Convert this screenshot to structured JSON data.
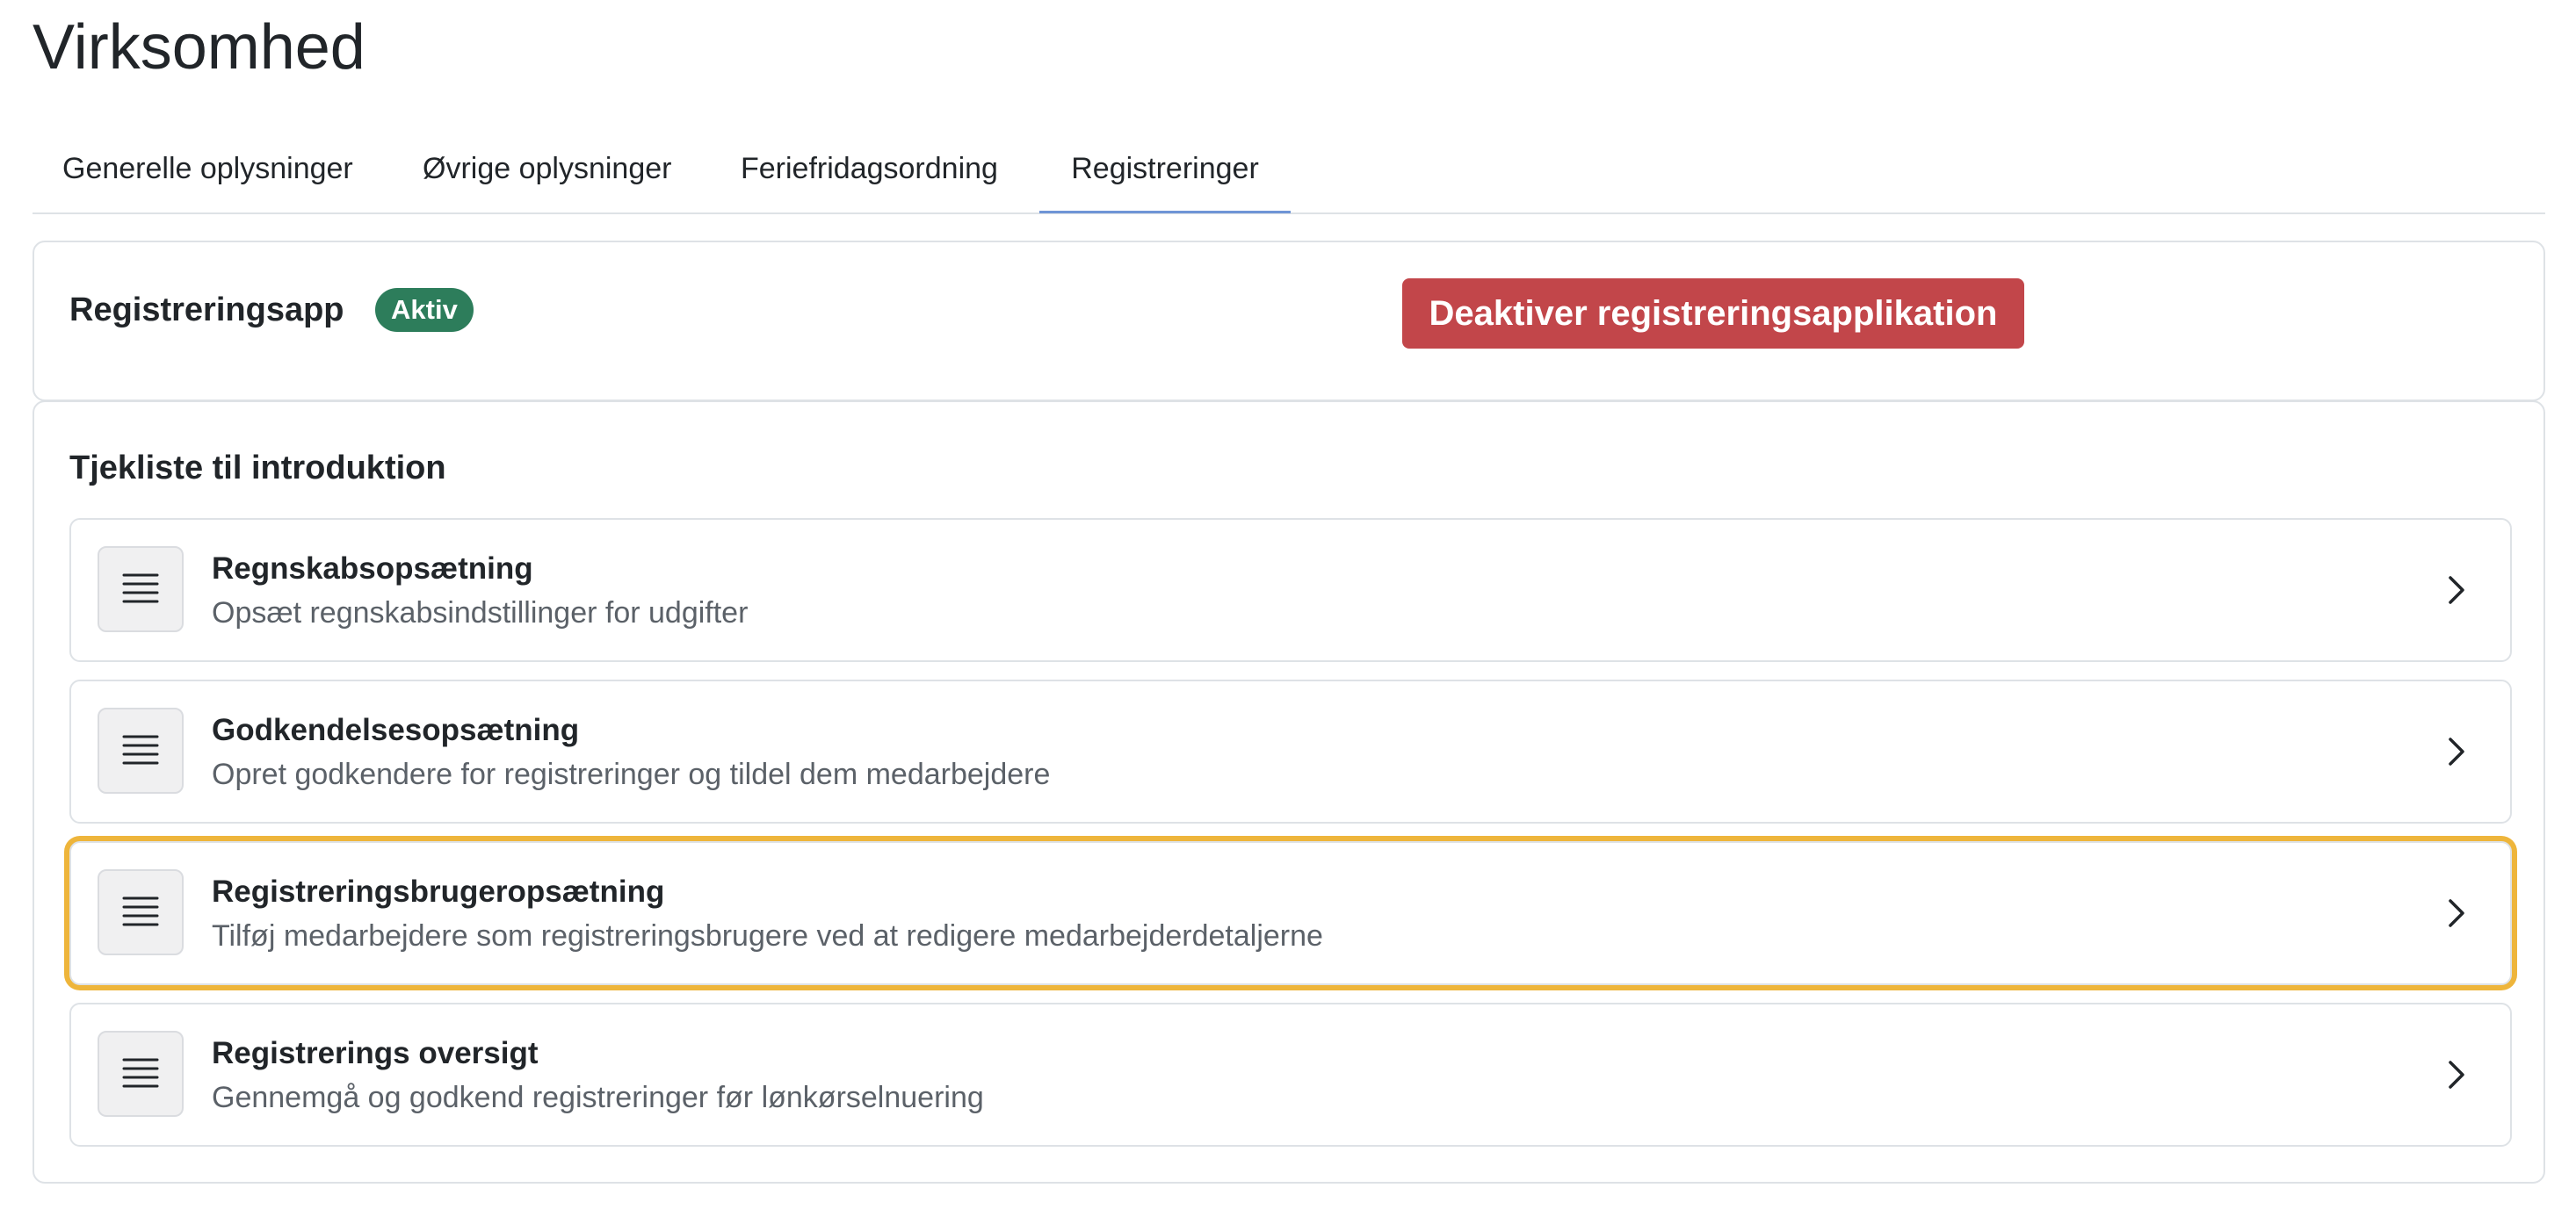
{
  "page": {
    "title": "Virksomhed"
  },
  "tabs": [
    {
      "label": "Generelle oplysninger",
      "active": false
    },
    {
      "label": "Øvrige oplysninger",
      "active": false
    },
    {
      "label": "Feriefridagsordning",
      "active": false
    },
    {
      "label": "Registreringer",
      "active": true
    }
  ],
  "app_card": {
    "title": "Registreringsapp",
    "status_badge": "Aktiv",
    "deactivate_button": "Deaktiver registreringsapplikation"
  },
  "checklist": {
    "title": "Tjekliste til introduktion",
    "items": [
      {
        "title": "Regnskabsopsætning",
        "description": "Opsæt regnskabsindstillinger for udgifter",
        "icon": "list-icon",
        "highlighted": false
      },
      {
        "title": "Godkendelsesopsætning",
        "description": "Opret godkendere for registreringer og tildel dem medarbejdere",
        "icon": "list-icon",
        "highlighted": false
      },
      {
        "title": "Registreringsbrugeropsætning",
        "description": "Tilføj medarbejdere som registreringsbrugere ved at redigere medarbejderdetaljerne",
        "icon": "list-icon",
        "highlighted": true
      },
      {
        "title": "Registrerings oversigt",
        "description": "Gennemgå og godkend registreringer før lønkørselnuering",
        "icon": "list-icon",
        "highlighted": false
      }
    ]
  },
  "colors": {
    "active_badge": "#2d7d5b",
    "danger_button": "#c2464a",
    "highlight_outline": "#eeb53b",
    "active_tab_underline": "#6f95d6"
  }
}
